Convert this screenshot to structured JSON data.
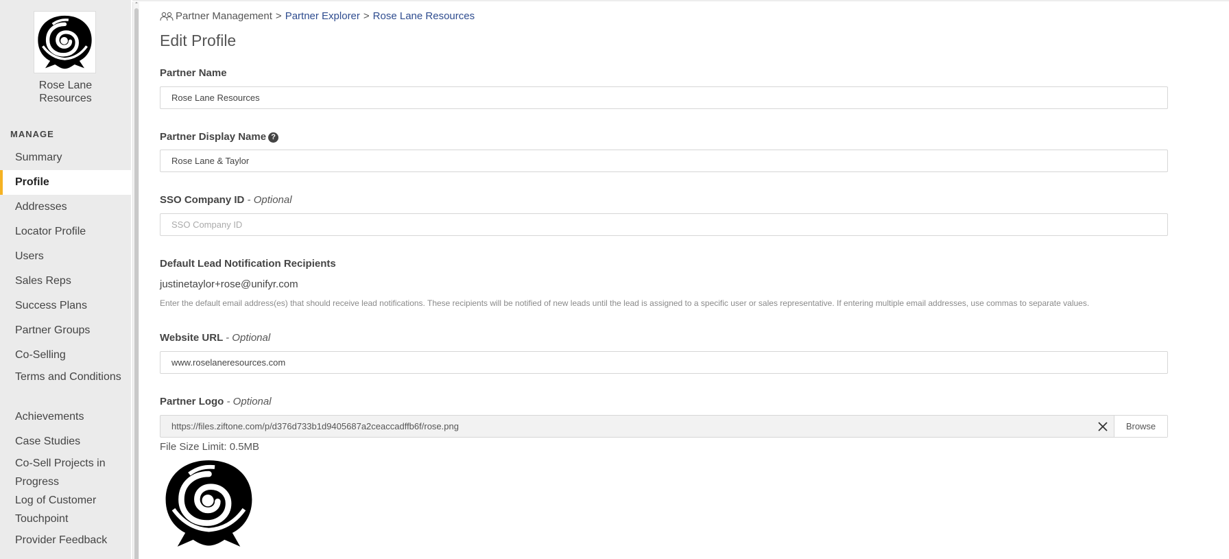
{
  "sidebar": {
    "company_name": "Rose Lane Resources",
    "section_label": "MANAGE",
    "items": [
      {
        "label": "Summary"
      },
      {
        "label": "Profile",
        "active": true
      },
      {
        "label": "Addresses"
      },
      {
        "label": "Locator Profile"
      },
      {
        "label": "Users"
      },
      {
        "label": "Sales Reps"
      },
      {
        "label": "Success Plans"
      },
      {
        "label": "Partner Groups"
      },
      {
        "label": "Co-Selling"
      },
      {
        "label": "Terms and Conditions"
      },
      {
        "label": "Achievements"
      },
      {
        "label": "Case Studies"
      },
      {
        "label": "Co-Sell Projects in Progress"
      },
      {
        "label": "Log of Customer Touchpoint"
      },
      {
        "label": "Provider Feedback"
      }
    ],
    "active_accent": "#f5b324"
  },
  "breadcrumb": {
    "root": "Partner Management",
    "separator": ">",
    "level2": "Partner Explorer",
    "level3": "Rose Lane Resources",
    "icon": "users-icon"
  },
  "page_title": "Edit Profile",
  "form": {
    "partner_name": {
      "label": "Partner Name",
      "value": "Rose Lane Resources"
    },
    "display_name": {
      "label": "Partner Display Name",
      "value": "Rose Lane & Taylor",
      "help_icon": "?"
    },
    "sso": {
      "label": "SSO Company ID",
      "optional": "- Optional",
      "placeholder": "SSO Company ID",
      "value": ""
    },
    "lead_recipients": {
      "label": "Default Lead Notification Recipients",
      "value": "justinetaylor+rose@unifyr.com",
      "help": "Enter the default email address(es) that should receive lead notifications. These recipients will be notified of new leads until the lead is assigned to a specific user or sales representative. If entering multiple email addresses, use commas to separate values."
    },
    "website": {
      "label": "Website URL",
      "optional": "- Optional",
      "value": "www.roselaneresources.com"
    },
    "logo": {
      "label": "Partner Logo",
      "optional": "- Optional",
      "url": "https://files.ziftone.com/p/d376d733b1d9405687a2ceaccadffb6f/rose.png",
      "browse_label": "Browse",
      "size_limit": "File Size Limit: 0.5MB"
    }
  },
  "colors": {
    "link": "#2e4c8f",
    "accent": "#f5b324"
  }
}
